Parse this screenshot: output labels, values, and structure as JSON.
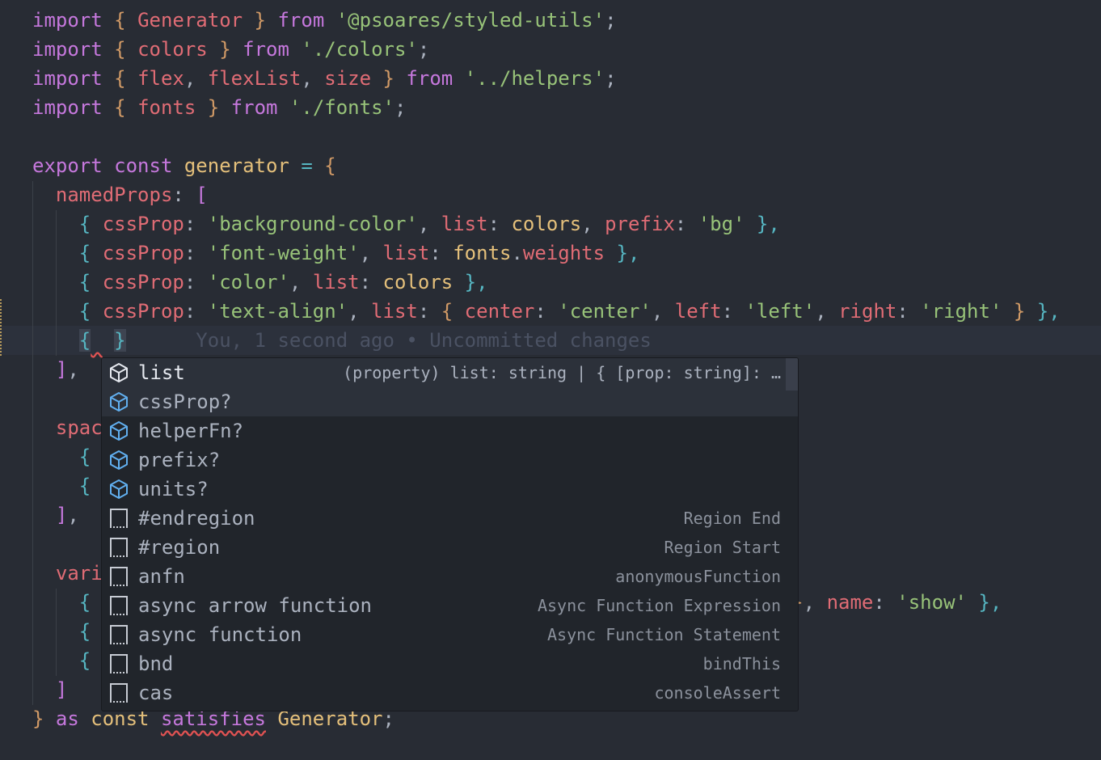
{
  "editor": {
    "lines": [
      {
        "row": 0,
        "tokens": [
          [
            "import ",
            "kw"
          ],
          [
            "{ ",
            "br"
          ],
          [
            "Generator",
            "id"
          ],
          [
            " } ",
            "br"
          ],
          [
            "from ",
            "kw"
          ],
          [
            "'@psoares/styled-utils'",
            "str"
          ],
          [
            ";",
            "pn"
          ]
        ]
      },
      {
        "row": 1,
        "tokens": [
          [
            "import ",
            "kw"
          ],
          [
            "{ ",
            "br"
          ],
          [
            "colors",
            "id"
          ],
          [
            " } ",
            "br"
          ],
          [
            "from ",
            "kw"
          ],
          [
            "'./colors'",
            "str"
          ],
          [
            ";",
            "pn"
          ]
        ]
      },
      {
        "row": 2,
        "tokens": [
          [
            "import ",
            "kw"
          ],
          [
            "{ ",
            "br"
          ],
          [
            "flex",
            "id"
          ],
          [
            ", ",
            "pn"
          ],
          [
            "flexList",
            "id"
          ],
          [
            ", ",
            "pn"
          ],
          [
            "size",
            "id"
          ],
          [
            " } ",
            "br"
          ],
          [
            "from ",
            "kw"
          ],
          [
            "'../helpers'",
            "str"
          ],
          [
            ";",
            "pn"
          ]
        ]
      },
      {
        "row": 3,
        "tokens": [
          [
            "import ",
            "kw"
          ],
          [
            "{ ",
            "br"
          ],
          [
            "fonts",
            "id"
          ],
          [
            " } ",
            "br"
          ],
          [
            "from ",
            "kw"
          ],
          [
            "'./fonts'",
            "str"
          ],
          [
            ";",
            "pn"
          ]
        ]
      },
      {
        "row": 5,
        "tokens": [
          [
            "export ",
            "kw"
          ],
          [
            "const ",
            "kw"
          ],
          [
            "generator",
            "ty"
          ],
          [
            " = ",
            "cy"
          ],
          [
            "{",
            "br"
          ]
        ]
      },
      {
        "row": 6,
        "tokens": [
          [
            "  namedProps",
            "id"
          ],
          [
            ": ",
            "pn"
          ],
          [
            "[",
            "kw"
          ]
        ]
      },
      {
        "row": 7,
        "tokens": [
          [
            "    { ",
            "cy"
          ],
          [
            "cssProp",
            "id"
          ],
          [
            ": ",
            "pn"
          ],
          [
            "'background-color'",
            "str"
          ],
          [
            ", ",
            "pn"
          ],
          [
            "list",
            "id"
          ],
          [
            ": ",
            "pn"
          ],
          [
            "colors",
            "ty"
          ],
          [
            ", ",
            "pn"
          ],
          [
            "prefix",
            "id"
          ],
          [
            ": ",
            "pn"
          ],
          [
            "'bg'",
            "str"
          ],
          [
            " },",
            "cy"
          ]
        ]
      },
      {
        "row": 8,
        "tokens": [
          [
            "    { ",
            "cy"
          ],
          [
            "cssProp",
            "id"
          ],
          [
            ": ",
            "pn"
          ],
          [
            "'font-weight'",
            "str"
          ],
          [
            ", ",
            "pn"
          ],
          [
            "list",
            "id"
          ],
          [
            ": ",
            "pn"
          ],
          [
            "fonts",
            "ty"
          ],
          [
            ".",
            "pn"
          ],
          [
            "weights",
            "id"
          ],
          [
            " },",
            "cy"
          ]
        ]
      },
      {
        "row": 9,
        "tokens": [
          [
            "    { ",
            "cy"
          ],
          [
            "cssProp",
            "id"
          ],
          [
            ": ",
            "pn"
          ],
          [
            "'color'",
            "str"
          ],
          [
            ", ",
            "pn"
          ],
          [
            "list",
            "id"
          ],
          [
            ": ",
            "pn"
          ],
          [
            "colors",
            "ty"
          ],
          [
            " },",
            "cy"
          ]
        ]
      },
      {
        "row": 10,
        "tokens": [
          [
            "    { ",
            "cy"
          ],
          [
            "cssProp",
            "id"
          ],
          [
            ": ",
            "pn"
          ],
          [
            "'text-align'",
            "str"
          ],
          [
            ", ",
            "pn"
          ],
          [
            "list",
            "id"
          ],
          [
            ": ",
            "pn"
          ],
          [
            "{ ",
            "br"
          ],
          [
            "center",
            "id"
          ],
          [
            ": ",
            "pn"
          ],
          [
            "'center'",
            "str"
          ],
          [
            ", ",
            "pn"
          ],
          [
            "left",
            "id"
          ],
          [
            ": ",
            "pn"
          ],
          [
            "'left'",
            "str"
          ],
          [
            ", ",
            "pn"
          ],
          [
            "right",
            "id"
          ],
          [
            ": ",
            "pn"
          ],
          [
            "'right'",
            "str"
          ],
          [
            " } ",
            "br"
          ],
          [
            "},",
            "cy"
          ]
        ]
      },
      {
        "row": 11,
        "tokens": [
          [
            "    ",
            "pn"
          ],
          [
            "{",
            "cy sel"
          ],
          [
            " ",
            "sq"
          ],
          [
            " ",
            "pn"
          ],
          [
            "}",
            "cy sel"
          ],
          [
            "      You, 1 second ago • Uncommitted changes",
            "ghost"
          ]
        ]
      },
      {
        "row": 12,
        "tokens": [
          [
            "  ]",
            "kw"
          ],
          [
            ",",
            "pn"
          ]
        ]
      },
      {
        "row": 14,
        "tokens": [
          [
            "  spac",
            "id"
          ]
        ]
      },
      {
        "row": 15,
        "tokens": [
          [
            "    {",
            "cy"
          ]
        ]
      },
      {
        "row": 16,
        "tokens": [
          [
            "    {",
            "cy"
          ]
        ]
      },
      {
        "row": 17,
        "tokens": [
          [
            "  ]",
            "kw"
          ],
          [
            ",",
            "pn"
          ]
        ]
      },
      {
        "row": 19,
        "tokens": [
          [
            "  vari",
            "id"
          ]
        ]
      },
      {
        "row": 20,
        "tokens": [
          [
            "    {",
            "cy"
          ],
          [
            "                                                            ",
            "pn"
          ],
          [
            "}",
            "br"
          ],
          [
            ", ",
            "pn"
          ],
          [
            "name",
            "id"
          ],
          [
            ": ",
            "pn"
          ],
          [
            "'show'",
            "str"
          ],
          [
            " },",
            "cy"
          ]
        ]
      },
      {
        "row": 21,
        "tokens": [
          [
            "    {",
            "cy"
          ]
        ]
      },
      {
        "row": 22,
        "tokens": [
          [
            "    {",
            "cy"
          ]
        ]
      },
      {
        "row": 23,
        "tokens": [
          [
            "  ]",
            "kw"
          ]
        ]
      },
      {
        "row": 24,
        "tokens": [
          [
            "}",
            "br"
          ],
          [
            " as ",
            "kw"
          ],
          [
            "const ",
            "ty"
          ],
          [
            "satisfies",
            "kw sq"
          ],
          [
            " Generator",
            "ty"
          ],
          [
            ";",
            "pn"
          ]
        ]
      }
    ]
  },
  "suggest": {
    "items": [
      {
        "label": "list",
        "detail": "(property) list: string | { [prop: string]: …",
        "icon": "property-cube-icon"
      },
      {
        "label": "cssProp?",
        "detail": "",
        "icon": "property-cube-icon"
      },
      {
        "label": "helperFn?",
        "detail": "",
        "icon": "property-cube-icon"
      },
      {
        "label": "prefix?",
        "detail": "",
        "icon": "property-cube-icon"
      },
      {
        "label": "units?",
        "detail": "",
        "icon": "property-cube-icon"
      },
      {
        "label": "#endregion",
        "detail": "Region End",
        "icon": "snippet-icon"
      },
      {
        "label": "#region",
        "detail": "Region Start",
        "icon": "snippet-icon"
      },
      {
        "label": "anfn",
        "detail": "anonymousFunction",
        "icon": "snippet-icon"
      },
      {
        "label": "async arrow function",
        "detail": "Async Function Expression",
        "icon": "snippet-icon"
      },
      {
        "label": "async function",
        "detail": "Async Function Statement",
        "icon": "snippet-icon"
      },
      {
        "label": "bnd",
        "detail": "bindThis",
        "icon": "snippet-icon"
      },
      {
        "label": "cas",
        "detail": "consoleAssert",
        "icon": "snippet-icon"
      }
    ],
    "selected_index": 0,
    "hover_index": 1
  },
  "colors": {
    "background": "#282c34",
    "popup": "#21252b",
    "keyword": "#c678dd",
    "identifier": "#e06c75",
    "string": "#98c379",
    "type": "#e5c07b",
    "brace": "#56b6c2",
    "property_icon": "#61afef"
  }
}
